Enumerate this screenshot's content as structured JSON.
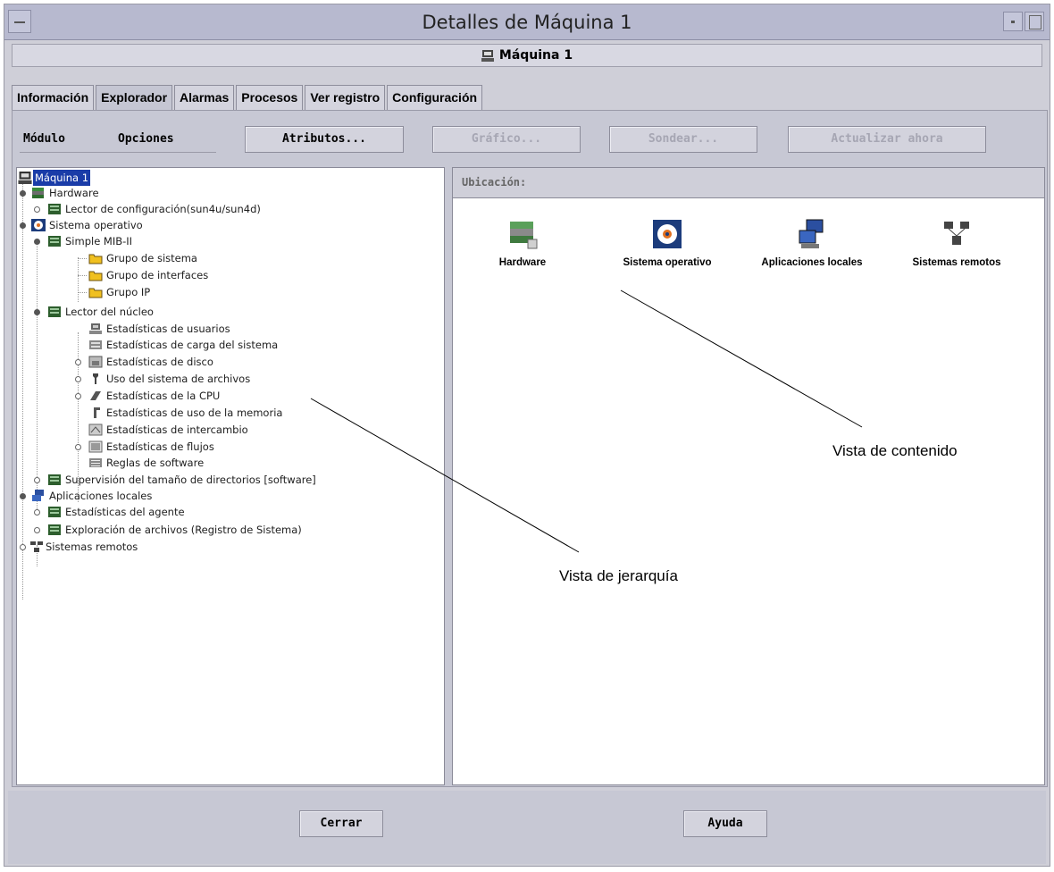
{
  "window": {
    "title": "Detalles de Máquina 1",
    "subtitle": "Máquina 1"
  },
  "tabs": [
    {
      "label": "Información",
      "active": false
    },
    {
      "label": "Explorador",
      "active": true
    },
    {
      "label": "Alarmas",
      "active": false
    },
    {
      "label": "Procesos",
      "active": false
    },
    {
      "label": "Ver registro",
      "active": false
    },
    {
      "label": "Configuración",
      "active": false
    }
  ],
  "toolbar": {
    "module_menu": "Módulo",
    "options_menu": "Opciones",
    "attributes_button": "Atributos...",
    "graph_button": "Gráfico...",
    "probe_button": "Sondear...",
    "refresh_button": "Actualizar ahora"
  },
  "tree": [
    {
      "label": "Máquina 1",
      "selected": true
    },
    {
      "label": "Hardware"
    },
    {
      "label": "Lector de configuración(sun4u/sun4d)"
    },
    {
      "label": "Sistema operativo"
    },
    {
      "label": "Simple MIB-II"
    },
    {
      "label": "Grupo de sistema"
    },
    {
      "label": "Grupo de interfaces"
    },
    {
      "label": "Grupo IP"
    },
    {
      "label": "Lector del núcleo"
    },
    {
      "label": "Estadísticas de usuarios"
    },
    {
      "label": "Estadísticas de carga del sistema"
    },
    {
      "label": "Estadísticas de disco"
    },
    {
      "label": "Uso del sistema de archivos"
    },
    {
      "label": "Estadísticas de la CPU"
    },
    {
      "label": "Estadísticas de uso de la memoria"
    },
    {
      "label": "Estadísticas de intercambio"
    },
    {
      "label": "Estadísticas de flujos"
    },
    {
      "label": "Reglas de software"
    },
    {
      "label": "Supervisión del tamaño de directorios [software]"
    },
    {
      "label": "Aplicaciones locales"
    },
    {
      "label": "Estadísticas del agente"
    },
    {
      "label": "Exploración de archivos (Registro de Sistema)"
    },
    {
      "label": "Sistemas remotos"
    }
  ],
  "content": {
    "location_label": "Ubicación:",
    "icons": [
      {
        "label": "Hardware",
        "icon": "hardware-icon"
      },
      {
        "label": "Sistema operativo",
        "icon": "operating-system-icon"
      },
      {
        "label": "Aplicaciones locales",
        "icon": "local-applications-icon"
      },
      {
        "label": "Sistemas remotos",
        "icon": "remote-systems-icon"
      }
    ]
  },
  "footer": {
    "close_button": "Cerrar",
    "help_button": "Ayuda"
  },
  "annotations": {
    "content_view": "Vista de contenido",
    "hierarchy_view": "Vista de jerarquía"
  }
}
